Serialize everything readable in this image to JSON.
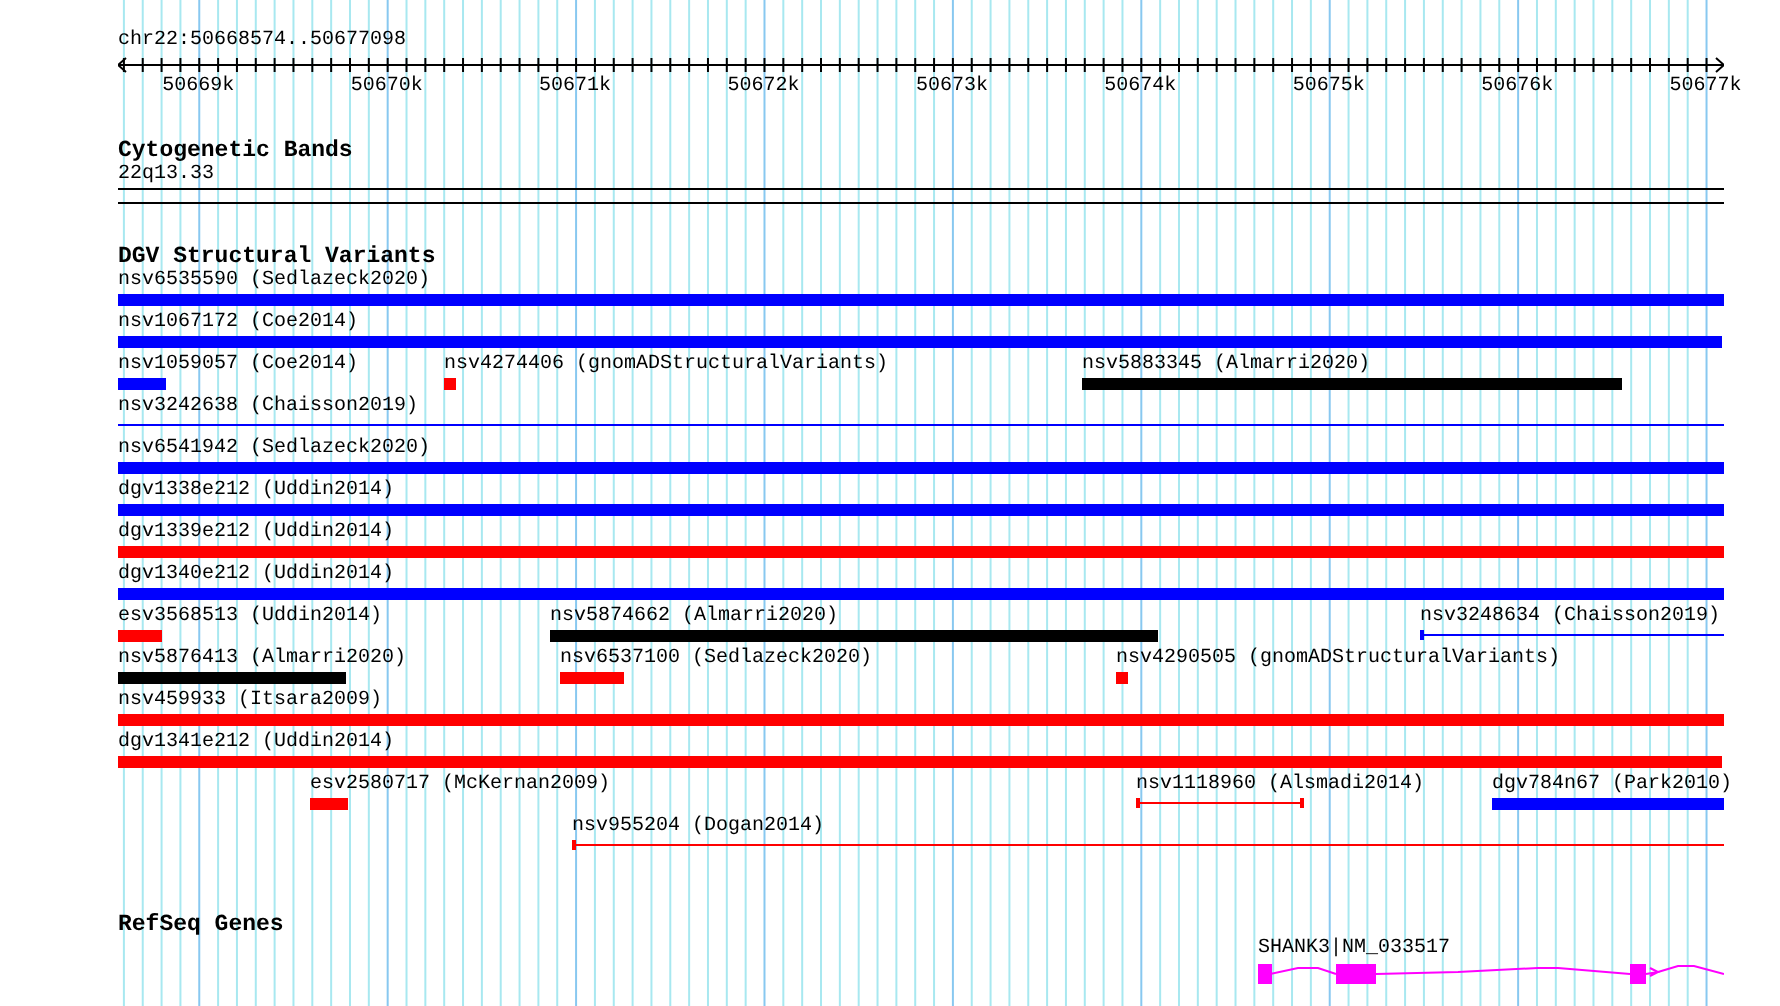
{
  "location": "chr22:50668574..50677098",
  "ruler": {
    "ticks": [
      "50669k",
      "50670k",
      "50671k",
      "50672k",
      "50673k",
      "50674k",
      "50675k",
      "50676k",
      "50677k"
    ]
  },
  "tracks": [
    {
      "kind": "bands",
      "title": "Cytogenetic Bands",
      "bands": [
        {
          "label": "22q13.33"
        }
      ]
    },
    {
      "kind": "variants",
      "title": "DGV Structural Variants",
      "rows": [
        {
          "features": [
            {
              "label": "nsv6535590 (Sedlazeck2020)",
              "kind": "bar",
              "color": "#0000ff"
            }
          ]
        },
        {
          "features": [
            {
              "label": "nsv1067172 (Coe2014)",
              "kind": "bar",
              "color": "#0000ff"
            }
          ]
        },
        {
          "features": [
            {
              "label": "nsv1059057 (Coe2014)",
              "kind": "bar",
              "color": "#0000ff"
            },
            {
              "label": "nsv4274406 (gnomADStructuralVariants)",
              "kind": "bar",
              "color": "#ff0000"
            },
            {
              "label": "nsv5883345 (Almarri2020)",
              "kind": "bar",
              "color": "#000000"
            }
          ]
        },
        {
          "features": [
            {
              "label": "nsv3242638 (Chaisson2019)",
              "kind": "line",
              "color": "#0000ff"
            }
          ]
        },
        {
          "features": [
            {
              "label": "nsv6541942 (Sedlazeck2020)",
              "kind": "bar",
              "color": "#0000ff"
            }
          ]
        },
        {
          "features": [
            {
              "label": "dgv1338e212 (Uddin2014)",
              "kind": "bar",
              "color": "#0000ff"
            }
          ]
        },
        {
          "features": [
            {
              "label": "dgv1339e212 (Uddin2014)",
              "kind": "bar",
              "color": "#ff0000"
            }
          ]
        },
        {
          "features": [
            {
              "label": "dgv1340e212 (Uddin2014)",
              "kind": "bar",
              "color": "#0000ff"
            }
          ]
        },
        {
          "features": [
            {
              "label": "esv3568513 (Uddin2014)",
              "kind": "bar",
              "color": "#ff0000"
            },
            {
              "label": "nsv5874662 (Almarri2020)",
              "kind": "bar",
              "color": "#000000"
            },
            {
              "label": "nsv3248634 (Chaisson2019)",
              "kind": "line",
              "color": "#0000ff"
            }
          ]
        },
        {
          "features": [
            {
              "label": "nsv5876413 (Almarri2020)",
              "kind": "bar",
              "color": "#000000"
            },
            {
              "label": "nsv6537100 (Sedlazeck2020)",
              "kind": "bar",
              "color": "#ff0000"
            },
            {
              "label": "nsv4290505 (gnomADStructuralVariants)",
              "kind": "bar",
              "color": "#ff0000"
            }
          ]
        },
        {
          "features": [
            {
              "label": "nsv459933 (Itsara2009)",
              "kind": "bar",
              "color": "#ff0000"
            }
          ]
        },
        {
          "features": [
            {
              "label": "dgv1341e212 (Uddin2014)",
              "kind": "bar",
              "color": "#ff0000"
            }
          ]
        },
        {
          "features": [
            {
              "label": "esv2580717 (McKernan2009)",
              "kind": "bar",
              "color": "#ff0000"
            },
            {
              "label": "nsv1118960 (Alsmadi2014)",
              "kind": "line",
              "color": "#ff0000"
            },
            {
              "label": "dgv784n67 (Park2010)",
              "kind": "bar",
              "color": "#0000ff"
            }
          ]
        },
        {
          "features": [
            {
              "label": "nsv955204 (Dogan2014)",
              "kind": "line",
              "color": "#ff0000"
            }
          ]
        }
      ]
    },
    {
      "kind": "genes",
      "title": "RefSeq Genes",
      "genes": [
        {
          "label": "SHANK3|NM_033517"
        }
      ]
    }
  ]
}
